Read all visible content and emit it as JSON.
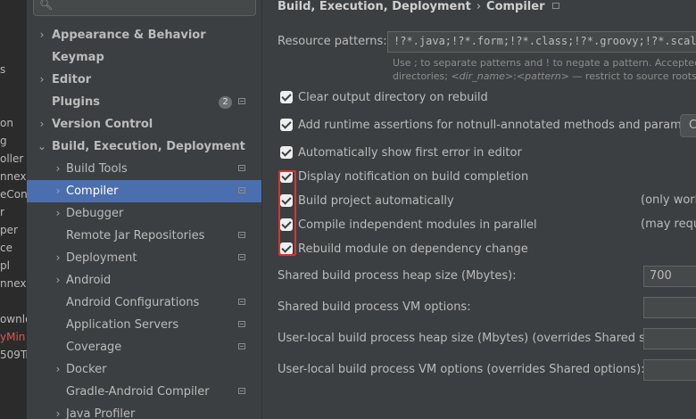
{
  "background_panel": {
    "lines": [
      "s",
      "on",
      "g",
      "oller",
      "nnexC",
      "eCon",
      "r",
      "per",
      "ce",
      "pl",
      "nnex1",
      "ownlo",
      "yMin",
      "509Tr"
    ],
    "highlight_color": "#e0544f"
  },
  "sidebar": {
    "search": {
      "placeholder": "",
      "icon": "search-icon"
    },
    "items": [
      {
        "label": "Appearance & Behavior",
        "arrow": "›",
        "bold": true
      },
      {
        "label": "Keymap",
        "bold": true
      },
      {
        "label": "Editor",
        "arrow": "›",
        "bold": true
      },
      {
        "label": "Plugins",
        "bold": true,
        "badge": "2"
      },
      {
        "label": "Version Control",
        "arrow": "›",
        "bold": true
      },
      {
        "label": "Build, Execution, Deployment",
        "arrow": "⌄",
        "bold": true
      },
      {
        "label": "Build Tools",
        "arrow": "›"
      },
      {
        "label": "Compiler",
        "arrow": "›",
        "selected": true
      },
      {
        "label": "Debugger",
        "arrow": "›"
      },
      {
        "label": "Remote Jar Repositories"
      },
      {
        "label": "Deployment",
        "arrow": "›"
      },
      {
        "label": "Android",
        "arrow": "›"
      },
      {
        "label": "Android Configurations"
      },
      {
        "label": "Application Servers"
      },
      {
        "label": "Coverage"
      },
      {
        "label": "Docker",
        "arrow": "›"
      },
      {
        "label": "Gradle-Android Compiler"
      },
      {
        "label": "Java Profiler",
        "arrow": "›"
      }
    ]
  },
  "breadcrumb": {
    "parent": "Build, Execution, Deployment",
    "separator": "›",
    "current": "Compiler"
  },
  "resource_patterns": {
    "label": "Resource patterns:",
    "value": "!?*.java;!?*.form;!?*.class;!?*.groovy;!?*.scala;",
    "hint_line1": "Use ; to separate patterns and ! to negate a pattern. Accepted wil",
    "hint_line2_prefix": "directories; ",
    "hint_line2_dirname": "<dir_name>",
    "hint_line2_mid": ":",
    "hint_line2_pattern": "<pattern>",
    "hint_line2_suffix": " — restrict to source roots with"
  },
  "checkboxes": [
    {
      "label": "Clear output directory on rebuild",
      "checked": true
    },
    {
      "label": "Add runtime assertions for notnull-annotated methods and parameters",
      "checked": true
    },
    {
      "label": "Automatically show first error in editor",
      "checked": true
    },
    {
      "label": "Display notification on build completion",
      "checked": true
    },
    {
      "label": "Build project automatically",
      "checked": true
    },
    {
      "label": "Compile independent modules in parallel",
      "checked": true
    },
    {
      "label": "Rebuild module on dependency change",
      "checked": true
    }
  ],
  "side_notes": {
    "build_auto": "(only work",
    "parallel": "(may requi"
  },
  "right_button_label": "C",
  "fields": {
    "shared_heap": {
      "label": "Shared build process heap size (Mbytes):",
      "value": "700"
    },
    "shared_vm": {
      "label": "Shared build process VM options:",
      "value": ""
    },
    "user_heap": {
      "label": "User-local build process heap size (Mbytes) (overrides Shared size):",
      "value": ""
    },
    "user_vm": {
      "label": "User-local build process VM options (overrides Shared options):",
      "value": ""
    }
  },
  "colors": {
    "selection": "#4b6eaf",
    "highlight_box": "#e03030",
    "panel": "#3c3f41"
  }
}
